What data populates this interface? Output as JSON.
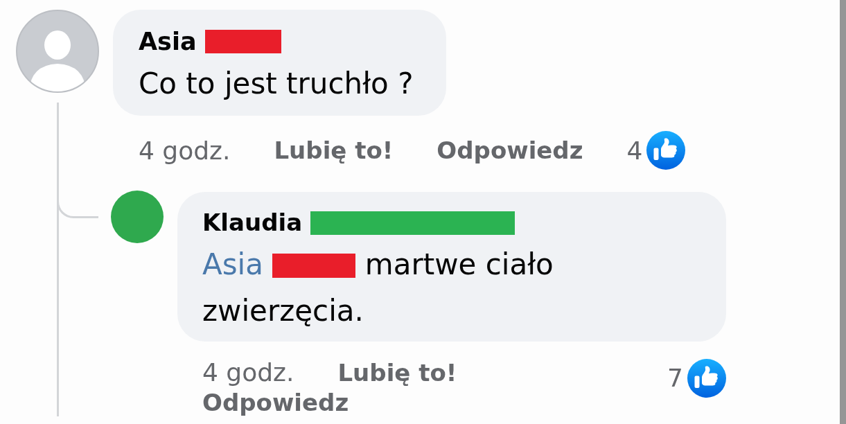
{
  "comments": [
    {
      "author": {
        "name": "Asia",
        "redaction": {
          "color": "#e91e2a"
        }
      },
      "avatar": {
        "kind": "silhouette"
      },
      "text": "Co to jest truchło ?",
      "time": "4 godz.",
      "actions": [
        "Lubię to!",
        "Odpowiedz"
      ],
      "reaction_count": "4",
      "replies": [
        {
          "author": {
            "name": "Klaudia",
            "redaction": {
              "color": "#2bb352"
            }
          },
          "avatar": {
            "kind": "solid",
            "color": "#2fa94e"
          },
          "mention": {
            "name": "Asia",
            "redaction": {
              "color": "#e91e2a"
            }
          },
          "text": "martwe ciało zwierzęcia.",
          "time": "4 godz.",
          "actions": [
            "Lubię to!",
            "Odpowiedz"
          ],
          "reaction_count": "7"
        }
      ]
    }
  ]
}
